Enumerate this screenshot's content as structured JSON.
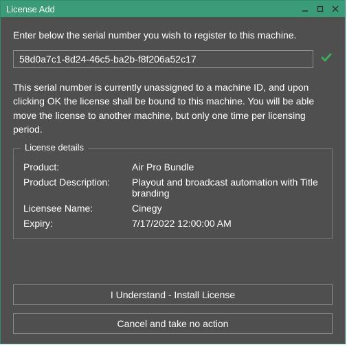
{
  "window": {
    "title": "License Add"
  },
  "instruction": "Enter below the serial number you wish to register to this machine.",
  "serial": {
    "value": "58d0a7c1-8d24-46c5-ba2b-f8f206a52c17"
  },
  "status_text": "This serial number is currently unassigned to a machine ID, and upon clicking OK the license shall be bound to this machine. You will be able move the license to another machine, but only one time per licensing period.",
  "details": {
    "legend": "License details",
    "labels": {
      "product": "Product:",
      "product_description": "Product Description:",
      "licensee_name": "Licensee Name:",
      "expiry": "Expiry:"
    },
    "values": {
      "product": "Air Pro Bundle",
      "product_description": "Playout and broadcast automation with Title branding",
      "licensee_name": "Cinegy",
      "expiry": "7/17/2022 12:00:00 AM"
    }
  },
  "buttons": {
    "install": "I Understand - Install License",
    "cancel": "Cancel and take no action"
  }
}
